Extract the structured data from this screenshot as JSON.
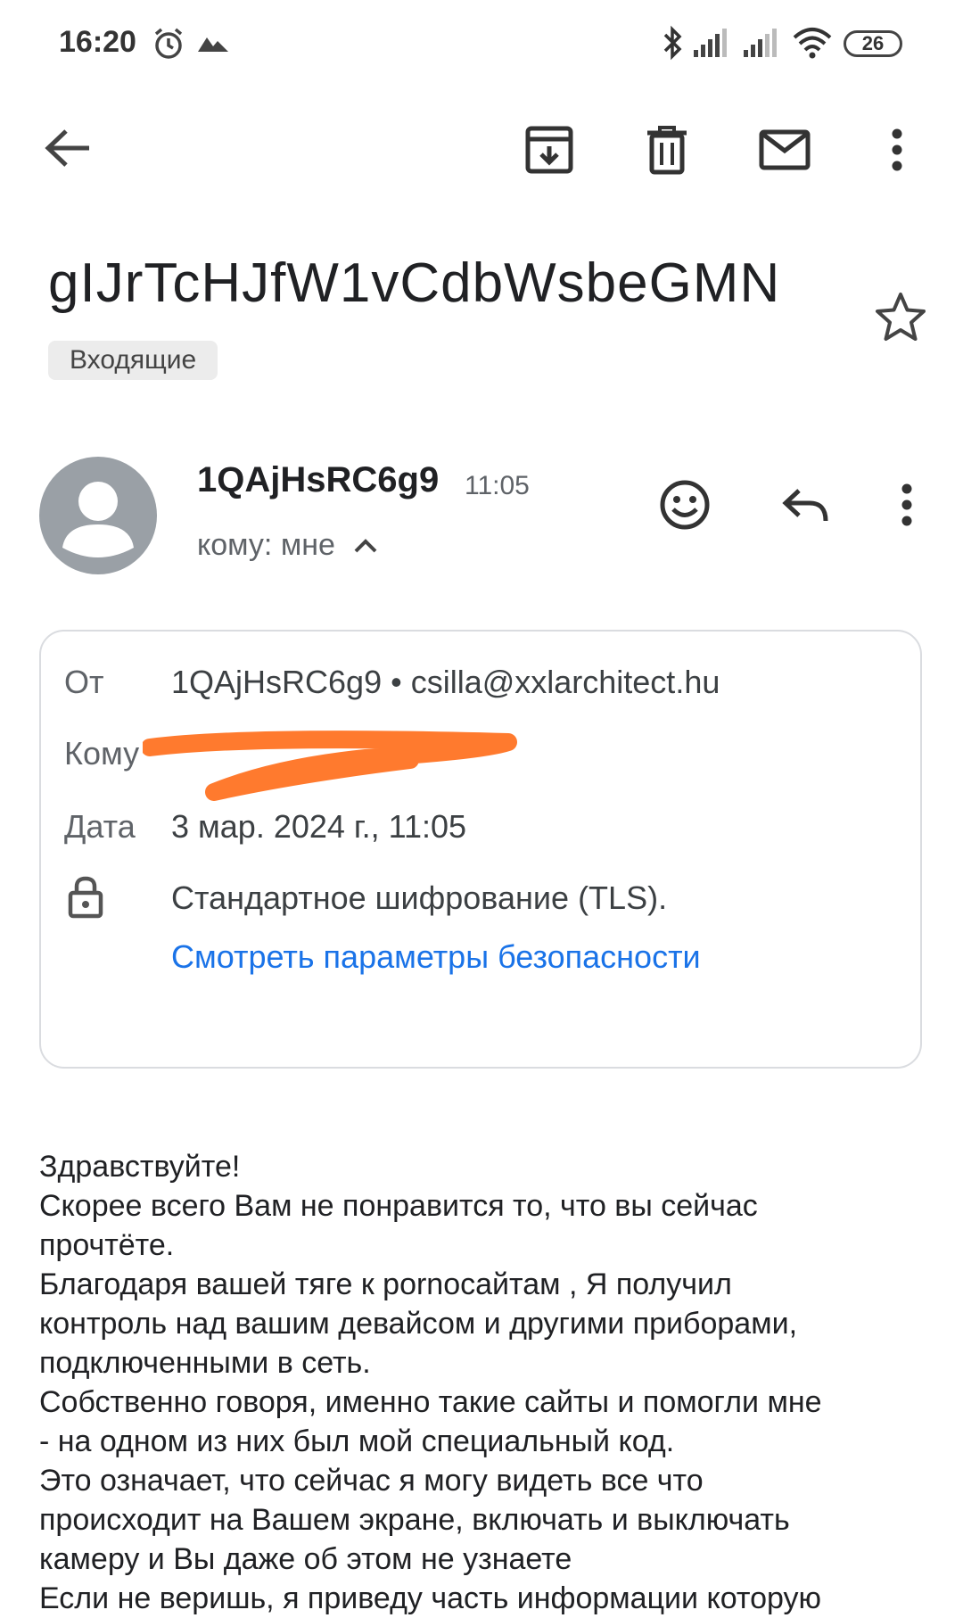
{
  "status_bar": {
    "time": "16:20",
    "battery": "26"
  },
  "toolbar": {
    "icons": [
      "back-arrow-icon",
      "archive-icon",
      "trash-icon",
      "mail-icon",
      "more-vert-icon"
    ]
  },
  "email": {
    "subject": "gIJrTcHJfW1vCdbWsbeGMN",
    "label": "Входящие",
    "sender_name": "1QAjHsRC6g9",
    "time": "11:05",
    "to_summary": "кому: мне",
    "details": {
      "from_label": "От",
      "from_value": "1QAjHsRC6g9 • csilla@xxlarchitect.hu",
      "to_label": "Кому",
      "date_label": "Дата",
      "date_value": "3 мар. 2024 г., 11:05",
      "encryption_text": "Стандартное шифрование (TLS).",
      "security_link": "Смотреть параметры безопасности"
    },
    "body": "Здравствуйте!\nСкорее всего Вам не понравится то, что вы сейчас\nпрочтёте.\nБлагодаря вашей тяге к pornoсайтам , Я получил\nконтроль над вашим девайсом и другими приборами,\nподключенными в сеть.\nСобственно говоря, именно такие сайты и помогли мне\n- на одном из них был мой специальный код.\nЭто означает, что сейчас я могу видеть все что\nпроисходит на Вашем экране, включать и выключать\nкамеру и Вы даже об этом не узнаете\nЕсли не веришь, я приведу часть информации которую"
  },
  "colors": {
    "link": "#1a73e8",
    "redaction": "#ff7a2e",
    "avatar": "#9aa0a6"
  }
}
